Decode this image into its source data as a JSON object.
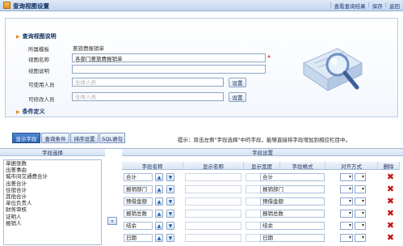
{
  "window": {
    "title": "查询视图设置",
    "actions": [
      "查看查询结果",
      "保存",
      "返回"
    ]
  },
  "section_view": {
    "title": "查询视图说明",
    "module_label": "所属模板",
    "module_value": "差旅费报销单",
    "name_label": "视图名称",
    "name_value": "各部门差旅费报销单",
    "desc_label": "视图说明",
    "desc_value": "",
    "users_label": "可使用人员",
    "users_placeholder": "全体人员",
    "editors_label": "可修改人员",
    "editors_placeholder": "全体人员",
    "settings_button": "设置"
  },
  "section_condition": {
    "title": "条件定义"
  },
  "tabs": [
    "显示字段",
    "查询条件",
    "排序设置",
    "SQL语句"
  ],
  "hint": "提示：双击左侧\"字段选择\"中的字段，能够直接将字段增加到相应栏目中。",
  "field_select": {
    "header": "字段选择",
    "items": [
      "单据张数",
      "出差事由",
      "城市间交通费合计",
      "出差合计",
      "住宿合计",
      "其他合计",
      "单位负责人",
      "财务审核",
      "证明人",
      "报销人"
    ]
  },
  "move_button": "»",
  "field_settings": {
    "header": "字段设置",
    "columns": [
      "字段名称",
      "显示名称",
      "显示宽度",
      "字段格式",
      "对齐方式",
      "删除"
    ],
    "rows": [
      {
        "name": "合计",
        "display": "合计"
      },
      {
        "name": "报销部门",
        "display": "报销部门"
      },
      {
        "name": "预借金额",
        "display": "预借金额"
      },
      {
        "name": "报销总数",
        "display": "报销总数"
      },
      {
        "name": "结余",
        "display": "结余"
      },
      {
        "name": "日期",
        "display": "日期"
      }
    ],
    "up_glyph": "▲",
    "down_glyph": "▼",
    "delete_glyph": "✖"
  },
  "colors": {
    "accent": "#2a63b4",
    "delete": "#c41414",
    "required": "#d40000"
  }
}
